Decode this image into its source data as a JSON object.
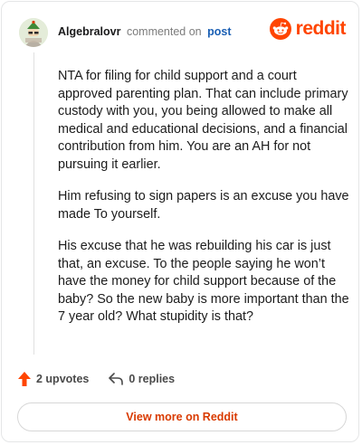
{
  "header": {
    "username": "Algebralovr",
    "commented_text": "commented on",
    "post_link": "post"
  },
  "brand": {
    "wordmark": "reddit",
    "icon": "reddit-snoo-icon",
    "color": "#ff4500"
  },
  "comment": {
    "paragraphs": [
      "NTA for filing for child support and a court approved parenting plan. That can include primary custody with you, you being allowed to make all medical and educational decisions, and a financial contribution from him. You are an AH for not pursuing it earlier.",
      "Him refusing to sign papers is an excuse you have made To yourself.",
      "His excuse that he was rebuilding his car is just that, an excuse. To the people saying he won’t have the money for child support because of the baby? So the new baby is more important than the 7 year old? What stupidity is that?"
    ]
  },
  "actions": {
    "upvotes": "2 upvotes",
    "upvote_icon": "upvote-arrow-icon",
    "replies": "0 replies",
    "reply_icon": "reply-arrow-icon"
  },
  "footer": {
    "view_more_label": "View more on Reddit",
    "accent": "#d93a00"
  }
}
